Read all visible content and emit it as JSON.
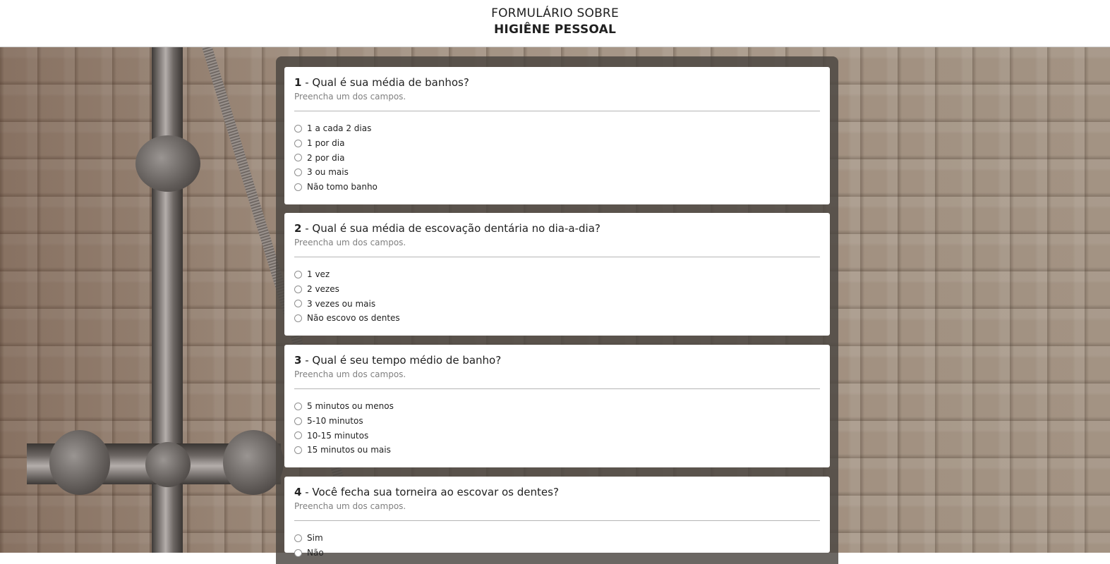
{
  "header": {
    "line1": "FORMULÁRIO SOBRE",
    "line2": "HIGIÊNE PESSOAL"
  },
  "questions": [
    {
      "number": "1",
      "text": " - Qual é sua média de banhos?",
      "hint": "Preencha um dos campos.",
      "options": [
        "1 a cada 2 dias",
        "1 por dia",
        "2 por dia",
        "3 ou mais",
        "Não tomo banho"
      ]
    },
    {
      "number": "2",
      "text": " - Qual é sua média de escovação dentária no dia-a-dia?",
      "hint": "Preencha um dos campos.",
      "options": [
        "1 vez",
        "2 vezes",
        "3 vezes ou mais",
        "Não escovo os dentes"
      ]
    },
    {
      "number": "3",
      "text": " - Qual é seu tempo médio de banho?",
      "hint": "Preencha um dos campos.",
      "options": [
        "5 minutos ou menos",
        "5-10 minutos",
        "10-15 minutos",
        "15 minutos ou mais"
      ]
    },
    {
      "number": "4",
      "text": " - Você fecha sua torneira ao escovar os dentes?",
      "hint": "Preencha um dos campos.",
      "options": [
        "Sim",
        "Não"
      ]
    }
  ]
}
